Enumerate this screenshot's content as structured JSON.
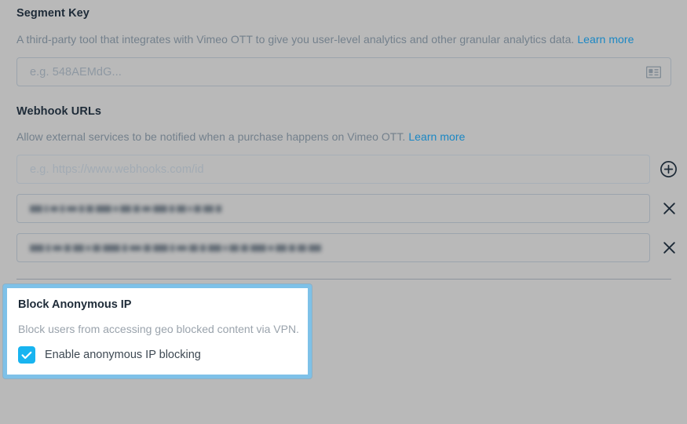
{
  "theme": {
    "overlay_background": "#b9b9b9",
    "heading_color": "#1e2b38",
    "muted_text_color": "#73808c",
    "link_color": "#1a87c4",
    "highlight_border_color": "#7ec1e8",
    "checkbox_color": "#18b4f0",
    "card_background": "#ffffff",
    "input_border_color": "#9ba4ad"
  },
  "segment_key": {
    "title": "Segment Key",
    "description": "A third-party tool that integrates with Vimeo OTT to give you user-level analytics and other granular analytics data.",
    "learn_more_label": "Learn more",
    "input": {
      "value": "",
      "placeholder": "e.g. 548AEMdG...",
      "trailing_icon": "contact-card-icon"
    }
  },
  "webhook_urls": {
    "title": "Webhook URLs",
    "description": "Allow external services to be notified when a purchase happens on Vimeo OTT.",
    "learn_more_label": "Learn more",
    "new_row": {
      "value": "",
      "placeholder": "e.g. https://www.webhooks.com/id",
      "action_icon": "plus-circle-icon",
      "action_label": "Add webhook URL"
    },
    "rows": [
      {
        "value": "",
        "redacted": true,
        "action_icon": "close-icon",
        "action_label": "Remove webhook URL"
      },
      {
        "value": "",
        "redacted": true,
        "action_icon": "close-icon",
        "action_label": "Remove webhook URL"
      }
    ]
  },
  "block_anonymous_ip": {
    "title": "Block Anonymous IP",
    "description": "Block users from accessing geo blocked content via VPN.",
    "checkbox": {
      "label": "Enable anonymous IP blocking",
      "checked": true
    }
  }
}
